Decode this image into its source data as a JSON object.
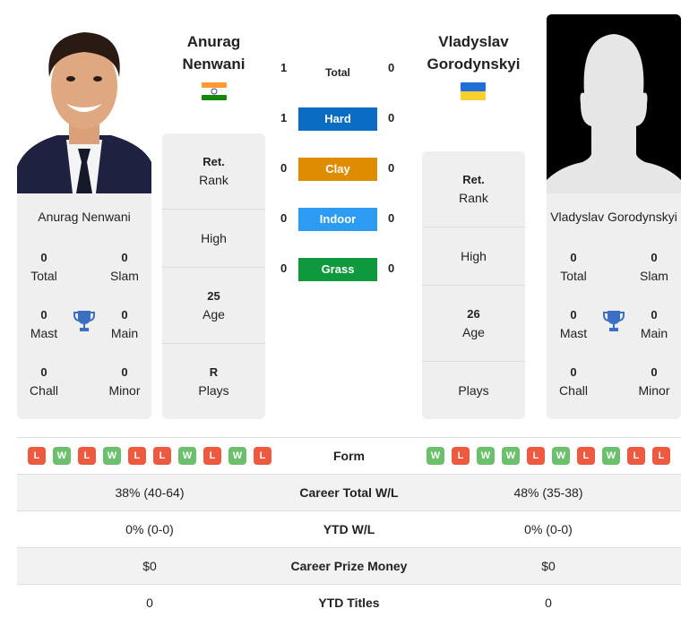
{
  "player_left": {
    "name": "Anurag Nenwani",
    "header_first": "Anurag",
    "header_last": "Nenwani",
    "flag": "india-flag",
    "titles": {
      "total": {
        "value": "0",
        "label": "Total"
      },
      "slam": {
        "value": "0",
        "label": "Slam"
      },
      "mast": {
        "value": "0",
        "label": "Mast"
      },
      "main": {
        "value": "0",
        "label": "Main"
      },
      "chall": {
        "value": "0",
        "label": "Chall"
      },
      "minor": {
        "value": "0",
        "label": "Minor"
      }
    },
    "stats": {
      "rank_value": "Ret.",
      "rank_label": "Rank",
      "high_label": "High",
      "age_value": "25",
      "age_label": "Age",
      "plays_value": "R",
      "plays_label": "Plays"
    },
    "form": [
      "L",
      "W",
      "L",
      "W",
      "L",
      "L",
      "W",
      "L",
      "W",
      "L"
    ]
  },
  "player_right": {
    "name": "Vladyslav Gorodynskyi",
    "header_first": "Vladyslav",
    "header_last": "Gorodynskyi",
    "flag": "ukraine-flag",
    "titles": {
      "total": {
        "value": "0",
        "label": "Total"
      },
      "slam": {
        "value": "0",
        "label": "Slam"
      },
      "mast": {
        "value": "0",
        "label": "Mast"
      },
      "main": {
        "value": "0",
        "label": "Main"
      },
      "chall": {
        "value": "0",
        "label": "Chall"
      },
      "minor": {
        "value": "0",
        "label": "Minor"
      }
    },
    "stats": {
      "rank_value": "Ret.",
      "rank_label": "Rank",
      "high_label": "High",
      "age_value": "26",
      "age_label": "Age",
      "plays_value": "",
      "plays_label": "Plays"
    },
    "form": [
      "W",
      "L",
      "W",
      "W",
      "L",
      "W",
      "L",
      "W",
      "L",
      "L"
    ]
  },
  "h2h": [
    {
      "label": "Total",
      "left": "1",
      "right": "0",
      "color": ""
    },
    {
      "label": "Hard",
      "left": "1",
      "right": "0",
      "color": "#0a6cc2"
    },
    {
      "label": "Clay",
      "left": "0",
      "right": "0",
      "color": "#df8c00"
    },
    {
      "label": "Indoor",
      "left": "0",
      "right": "0",
      "color": "#2b9cf2"
    },
    {
      "label": "Grass",
      "left": "0",
      "right": "0",
      "color": "#0e9a3c"
    }
  ],
  "comparison": {
    "form_label": "Form",
    "rows": [
      {
        "label": "Career Total W/L",
        "left": "38% (40-64)",
        "right": "48% (35-38)"
      },
      {
        "label": "YTD W/L",
        "left": "0% (0-0)",
        "right": "0% (0-0)"
      },
      {
        "label": "Career Prize Money",
        "left": "$0",
        "right": "$0"
      },
      {
        "label": "YTD Titles",
        "left": "0",
        "right": "0"
      }
    ]
  },
  "colors": {
    "win": "#6cbf6c",
    "loss": "#ee5a40",
    "trophy": "#3a6fc4",
    "card_bg": "#efefef"
  }
}
